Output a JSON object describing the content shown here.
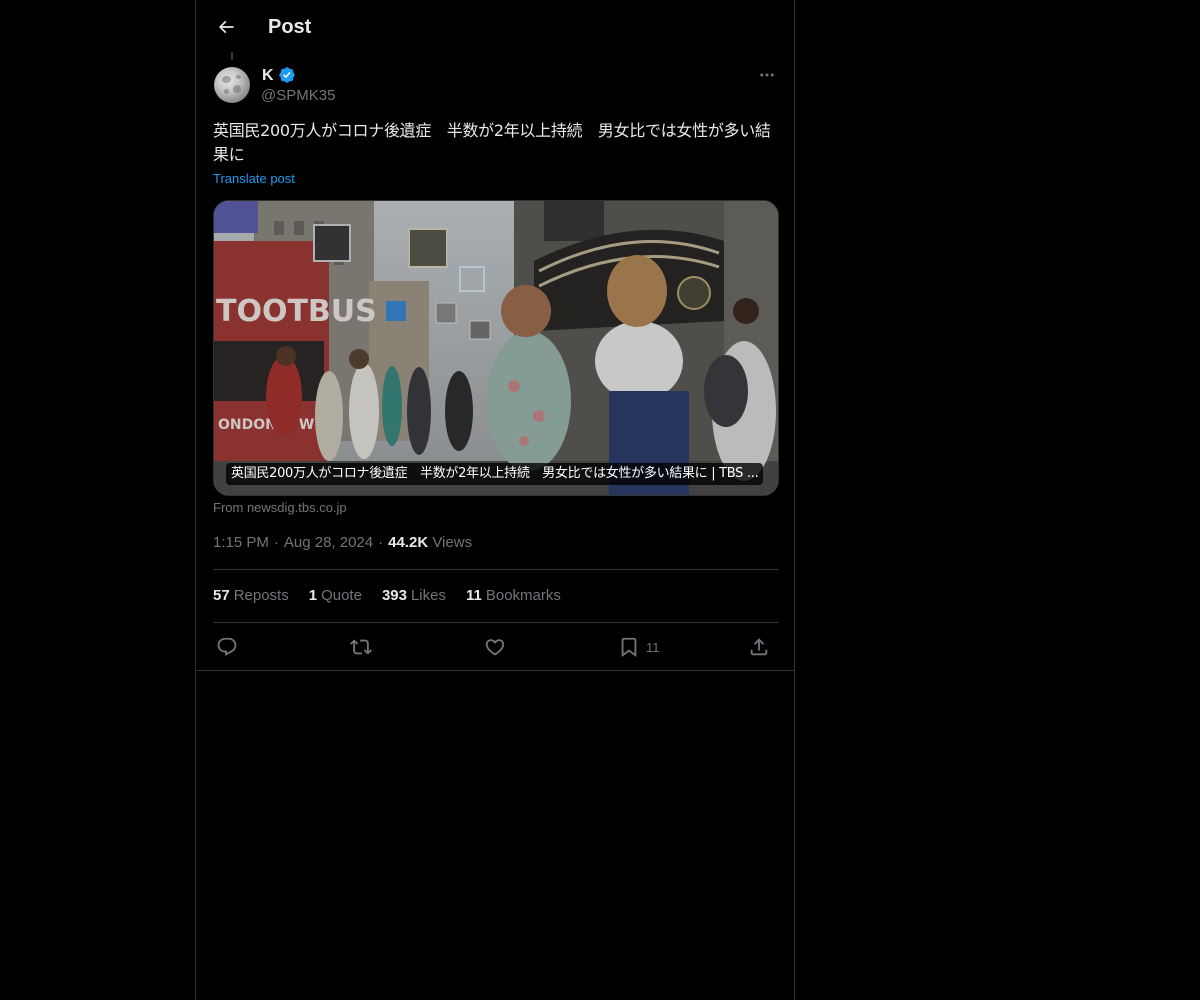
{
  "header": {
    "title": "Post",
    "back_icon": "arrow-left-icon"
  },
  "author": {
    "display_name": "K",
    "handle": "@SPMK35",
    "verified": true,
    "verified_color": "#1d9bf0",
    "avatar_icon": "moon-avatar"
  },
  "post": {
    "text": "英国民200万人がコロナ後遺症　半数が2年以上持続　男女比では女性が多い結果に",
    "translate_label": "Translate post",
    "more_icon": "more-horizontal-icon"
  },
  "media": {
    "caption": "英国民200万人がコロナ後遺症　半数が2年以上持続　男女比では女性が多い結果に | TBS ...",
    "source": "From newsdig.tbs.co.jp"
  },
  "meta": {
    "time": "1:15 PM",
    "date": "Aug 28, 2024",
    "views_count": "44.2K",
    "views_label": "Views"
  },
  "stats": {
    "reposts_count": "57",
    "reposts_label": "Reposts",
    "quotes_count": "1",
    "quotes_label": "Quote",
    "likes_count": "393",
    "likes_label": "Likes",
    "bookmarks_count": "11",
    "bookmarks_label": "Bookmarks"
  },
  "actions": {
    "reply_icon": "reply-icon",
    "repost_icon": "repost-icon",
    "like_icon": "heart-icon",
    "bookmark_icon": "bookmark-icon",
    "bookmark_count": "11",
    "share_icon": "share-icon"
  },
  "colors": {
    "background": "#000000",
    "text_primary": "#e7e9ea",
    "text_secondary": "#71767b",
    "accent": "#1d9bf0",
    "border": "#2f3336"
  }
}
